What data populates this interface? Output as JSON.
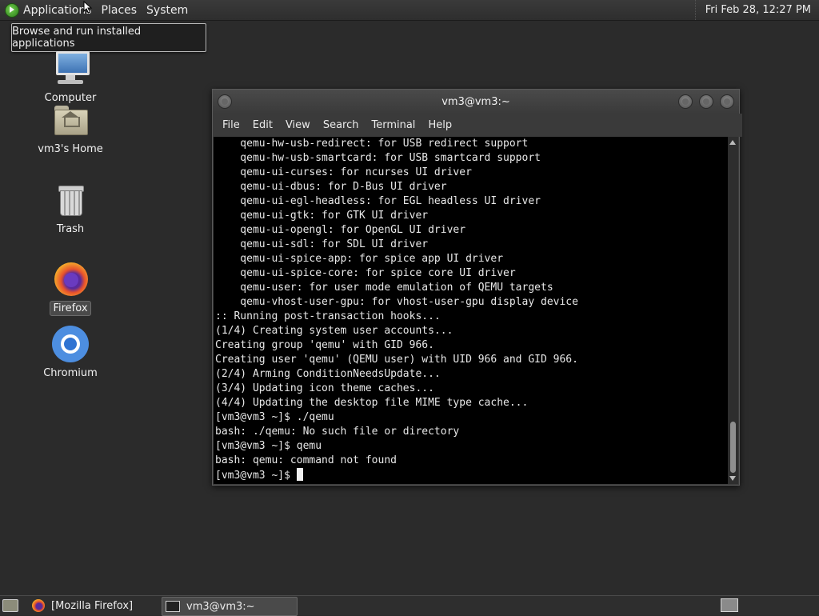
{
  "top_panel": {
    "menus": [
      "Applications",
      "Places",
      "System"
    ],
    "clock": "Fri Feb 28, 12:27 PM"
  },
  "tooltip": {
    "text": "Browse and run installed applications"
  },
  "desktop_icons": [
    {
      "label": "Computer",
      "icon": "computer-icon"
    },
    {
      "label": "vm3's Home",
      "icon": "home-folder-icon"
    },
    {
      "label": "Trash",
      "icon": "trash-icon"
    },
    {
      "label": "Firefox",
      "icon": "firefox-icon",
      "selected": true
    },
    {
      "label": "Chromium",
      "icon": "chromium-icon"
    }
  ],
  "terminal": {
    "title": "vm3@vm3:~",
    "menu": [
      "File",
      "Edit",
      "View",
      "Search",
      "Terminal",
      "Help"
    ],
    "lines": [
      "    qemu-hw-usb-redirect: for USB redirect support",
      "    qemu-hw-usb-smartcard: for USB smartcard support",
      "    qemu-ui-curses: for ncurses UI driver",
      "    qemu-ui-dbus: for D-Bus UI driver",
      "    qemu-ui-egl-headless: for EGL headless UI driver",
      "    qemu-ui-gtk: for GTK UI driver",
      "    qemu-ui-opengl: for OpenGL UI driver",
      "    qemu-ui-sdl: for SDL UI driver",
      "    qemu-ui-spice-app: for spice app UI driver",
      "    qemu-ui-spice-core: for spice core UI driver",
      "    qemu-user: for user mode emulation of QEMU targets",
      "    qemu-vhost-user-gpu: for vhost-user-gpu display device",
      ":: Running post-transaction hooks...",
      "(1/4) Creating system user accounts...",
      "Creating group 'qemu' with GID 966.",
      "Creating user 'qemu' (QEMU user) with UID 966 and GID 966.",
      "(2/4) Arming ConditionNeedsUpdate...",
      "(3/4) Updating icon theme caches...",
      "(4/4) Updating the desktop file MIME type cache...",
      "[vm3@vm3 ~]$ ./qemu",
      "bash: ./qemu: No such file or directory",
      "[vm3@vm3 ~]$ qemu",
      "bash: qemu: command not found"
    ],
    "prompt": "[vm3@vm3 ~]$ "
  },
  "taskbar": {
    "tasks": [
      {
        "label": "[Mozilla Firefox]",
        "icon": "firefox-icon",
        "active": false
      },
      {
        "label": "vm3@vm3:~",
        "icon": "terminal-icon",
        "active": true
      }
    ]
  }
}
